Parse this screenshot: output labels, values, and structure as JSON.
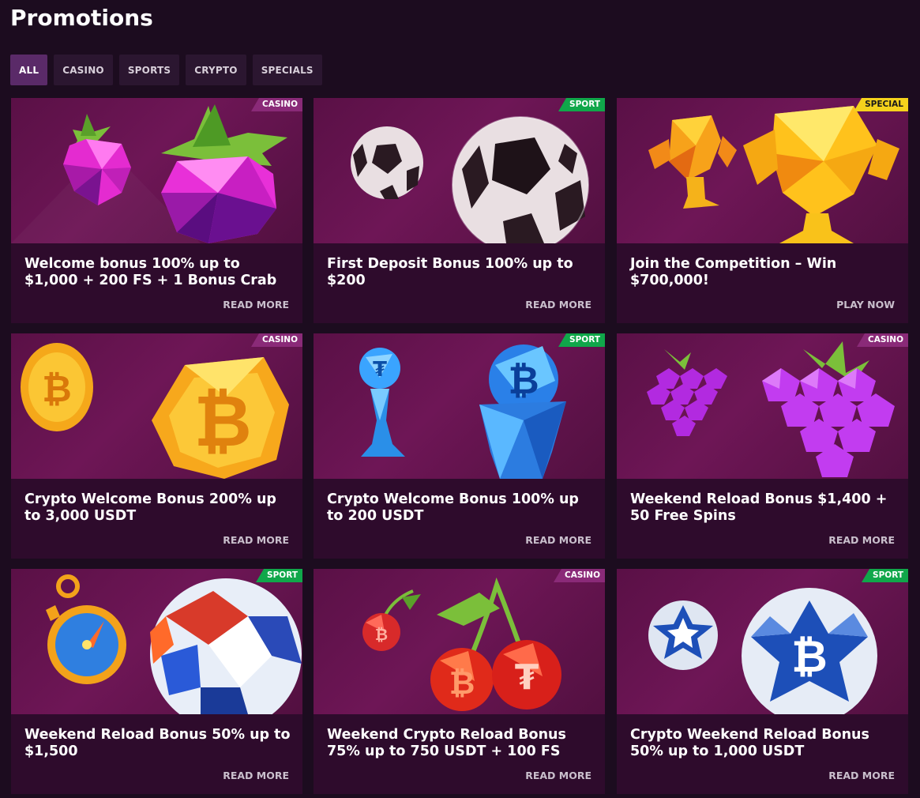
{
  "page": {
    "title": "Promotions"
  },
  "tabs": [
    {
      "label": "ALL",
      "active": true
    },
    {
      "label": "CASINO",
      "active": false
    },
    {
      "label": "SPORTS",
      "active": false
    },
    {
      "label": "CRYPTO",
      "active": false
    },
    {
      "label": "SPECIALS",
      "active": false
    }
  ],
  "badge_colors": {
    "CASINO": "#8a2a78",
    "SPORT": "#10a74a",
    "SPECIAL": "#f5d21c"
  },
  "cards": [
    {
      "badge": "CASINO",
      "title": "Welcome bonus 100% up to $1,000 + 200 FS + 1 Bonus Crab",
      "action": "READ MORE",
      "art": "gem-berry"
    },
    {
      "badge": "SPORT",
      "title": "First Deposit Bonus 100% up to $200",
      "action": "READ MORE",
      "art": "soccer-ball"
    },
    {
      "badge": "SPECIAL",
      "title": "Join the Competition – Win $700,000!",
      "action": "PLAY NOW",
      "art": "trophy"
    },
    {
      "badge": "CASINO",
      "title": "Crypto Welcome Bonus 200% up to 3,000 USDT",
      "action": "READ MORE",
      "art": "bitcoin-coin"
    },
    {
      "badge": "SPORT",
      "title": "Crypto Welcome Bonus 100% up to 200 USDT",
      "action": "READ MORE",
      "art": "crypto-trophy"
    },
    {
      "badge": "CASINO",
      "title": "Weekend Reload Bonus $1,400 + 50 Free Spins",
      "action": "READ MORE",
      "art": "grapes"
    },
    {
      "badge": "SPORT",
      "title": "Weekend Reload Bonus 50% up to $1,500",
      "action": "READ MORE",
      "art": "stopwatch-ball"
    },
    {
      "badge": "CASINO",
      "title": "Weekend Crypto Reload Bonus 75% up to 750 USDT + 100 FS",
      "action": "READ MORE",
      "art": "cherries"
    },
    {
      "badge": "SPORT",
      "title": "Crypto Weekend Reload Bonus 50% up to 1,000 USDT",
      "action": "READ MORE",
      "art": "bitcoin-ball"
    }
  ]
}
